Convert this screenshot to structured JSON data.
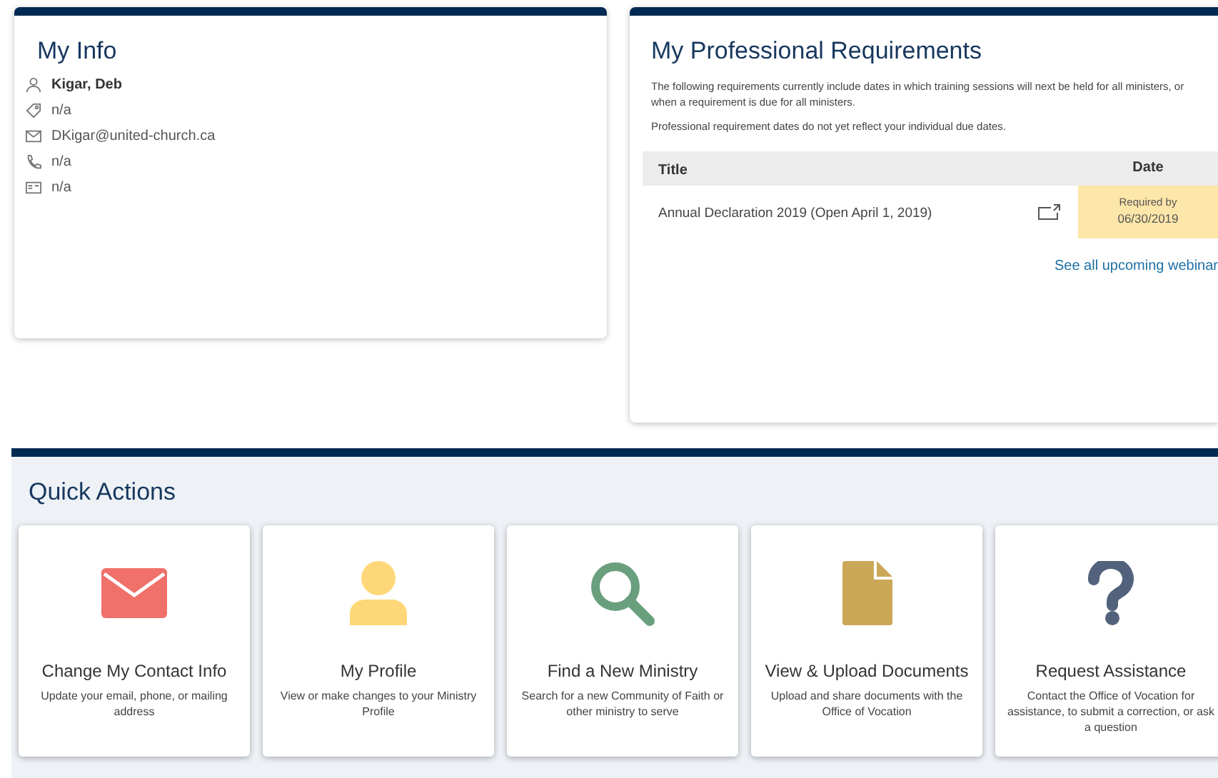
{
  "my_info": {
    "title": "My Info",
    "name": "Kigar, Deb",
    "rows": [
      {
        "kind": "tag",
        "text": "n/a"
      },
      {
        "kind": "mail",
        "text": "DKigar@united-church.ca"
      },
      {
        "kind": "phone",
        "text": "n/a"
      },
      {
        "kind": "card",
        "text": "n/a"
      }
    ]
  },
  "requirements": {
    "title": "My Professional Requirements",
    "notes": [
      "The following requirements currently include dates in which training sessions will next be held for all ministers, or when a requirement is due for all ministers.",
      "Professional requirement dates do not yet reflect your individual due dates."
    ],
    "table": {
      "columns": [
        "Title",
        "Date"
      ],
      "rows": [
        {
          "title": "Annual Declaration 2019 (Open April 1, 2019)",
          "date_label": "Required by",
          "date": "06/30/2019"
        }
      ]
    },
    "link": "See all upcoming webinar"
  },
  "quick_actions": {
    "title": "Quick Actions",
    "tiles": [
      {
        "kind": "envelope",
        "title": "Change My Contact Info",
        "text": "Update your email, phone, or mailing address"
      },
      {
        "kind": "person",
        "title": "My Profile",
        "text": "View or make changes to your Ministry Profile"
      },
      {
        "kind": "search",
        "title": "Find a New Ministry",
        "text": "Search for a new Community of Faith or other ministry to serve"
      },
      {
        "kind": "document",
        "title": "View & Upload Documents",
        "text": "Upload and share documents with the Office of Vocation"
      },
      {
        "kind": "question",
        "title": "Request Assistance",
        "text": "Contact the Office of Vocation for assistance, to submit a correction, or ask a question"
      }
    ]
  }
}
